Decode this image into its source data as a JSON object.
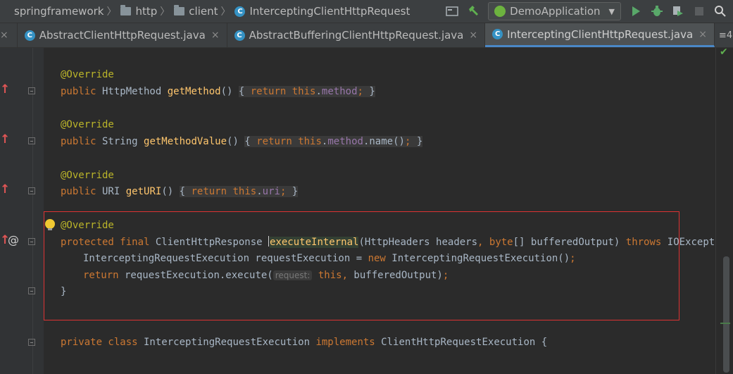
{
  "breadcrumb": {
    "items": [
      {
        "label": "springframework",
        "icon": "folder-icon"
      },
      {
        "label": "http",
        "icon": "folder-icon"
      },
      {
        "label": "client",
        "icon": "folder-icon"
      },
      {
        "label": "InterceptingClientHttpRequest",
        "icon": "class-icon"
      }
    ]
  },
  "toolbar": {
    "run_config": "DemoApplication",
    "class_icon_glyph": "C"
  },
  "tabs": [
    {
      "label": "AbstractClientHttpRequest.java",
      "active": false
    },
    {
      "label": "AbstractBufferingClientHttpRequest.java",
      "active": false
    },
    {
      "label": "InterceptingClientHttpRequest.java",
      "active": true
    }
  ],
  "tab_overflow": "≡4",
  "code": {
    "l1_ann": "@Override",
    "l2_pub": "public",
    "l2_type": " HttpMethod ",
    "l2_fn": "getMethod",
    "l2_paren": "() ",
    "l2_body_open": "{ ",
    "l2_ret": "return",
    "l2_this": " this",
    "l2_dot": ".",
    "l2_fld": "method",
    "l2_semi": "; ",
    "l2_close": "}",
    "l3_ann": "@Override",
    "l4_pub": "public",
    "l4_type": " String ",
    "l4_fn": "getMethodValue",
    "l4_paren": "() ",
    "l4_open": "{ ",
    "l4_ret": "return",
    "l4_this": " this",
    "l4_dot": ".",
    "l4_fld": "method",
    "l4_call": ".name()",
    "l4_semi": "; ",
    "l4_close": "}",
    "l5_ann": "@Override",
    "l6_pub": "public",
    "l6_type": " URI ",
    "l6_fn": "getURI",
    "l6_paren": "() ",
    "l6_open": "{ ",
    "l6_ret": "return",
    "l6_this": " this",
    "l6_dot": ".",
    "l6_fld": "uri",
    "l6_semi": "; ",
    "l6_close": "}",
    "l7_ann": "@Override",
    "l8_prot": "protected final",
    "l8_type": " ClientHttpResponse ",
    "l8_fn": "executeInternal",
    "l8_p1": "(HttpHeaders headers",
    "l8_comma": ", ",
    "l8_byte": "byte",
    "l8_p2": "[] bufferedOutput) ",
    "l8_throws": "throws",
    "l8_exc": " IOException {",
    "l9_type": "InterceptingRequestExecution requestExecution = ",
    "l9_new": "new",
    "l9_ctor": " InterceptingRequestExecution()",
    "l9_semi": ";",
    "l10_ret": "return",
    "l10_call": " requestExecution.execute(",
    "l10_hint": "request:",
    "l10_this": " this",
    "l10_comma": ", ",
    "l10_arg": "bufferedOutput)",
    "l10_semi": ";",
    "l11_close": "}",
    "l12_priv": "private class",
    "l12_name": " InterceptingRequestExecution ",
    "l12_impl": "implements",
    "l12_iface": " ClientHttpRequestExecution {"
  }
}
